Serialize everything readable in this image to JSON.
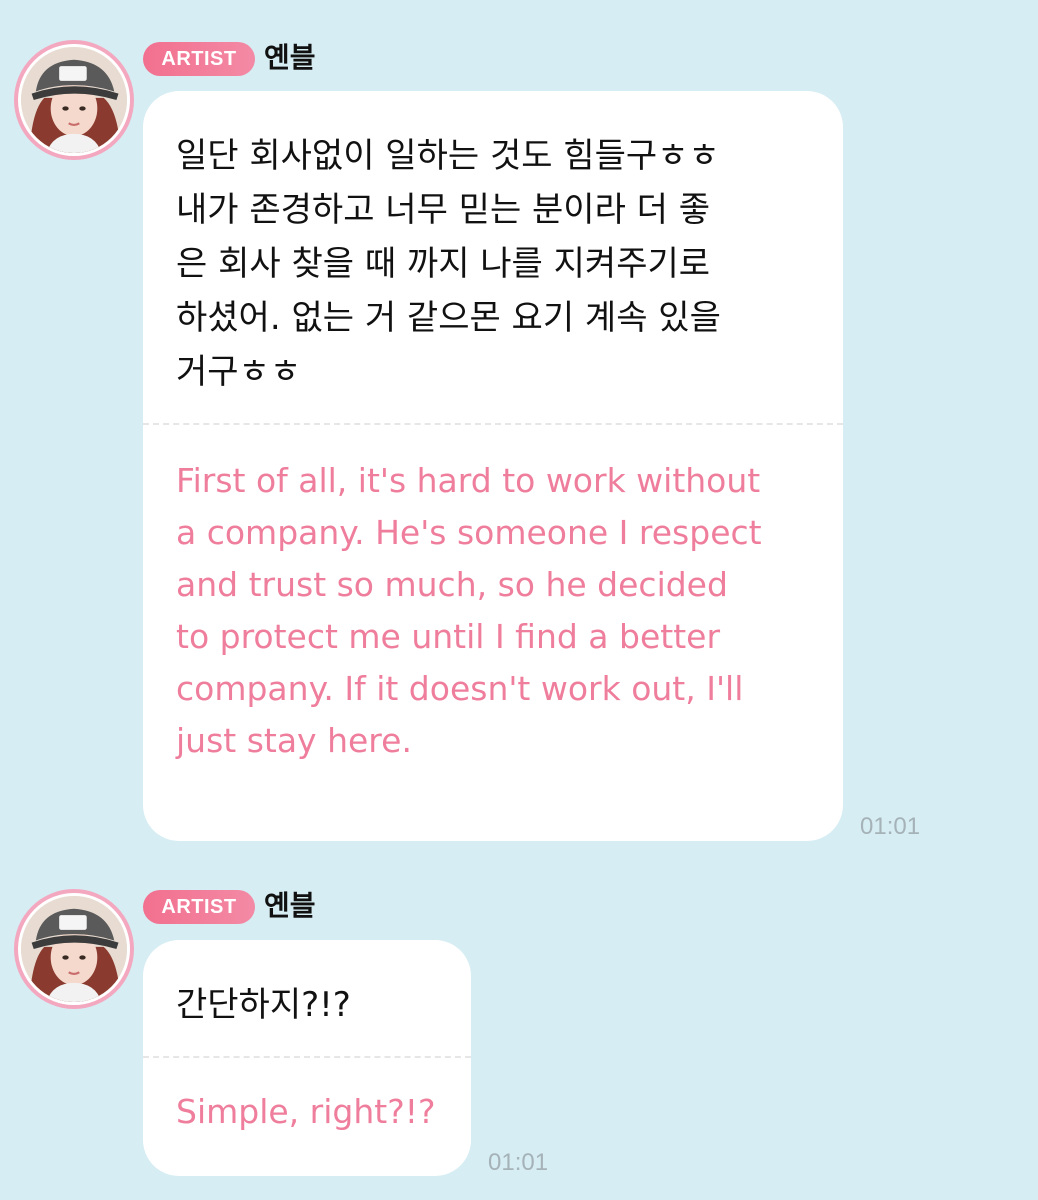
{
  "messages": [
    {
      "badge": "ARTIST",
      "sender": "옌블",
      "original_lines": [
        "일단 회사없이 일하는 것도 힘들구ㅎㅎ",
        "내가 존경하고 너무 믿는 분이라 더 좋",
        "은 회사 찾을 때 까지 나를 지켜주기로",
        "하셨어. 없는 거 같으몬 요기 계속 있을",
        "거구ㅎㅎ"
      ],
      "translation_lines": [
        "First of all, it's hard to work without",
        "a company. He's someone I respect",
        "and trust so much, so he decided",
        "to protect me until I find a better",
        "company. If it doesn't work out, I'll",
        "just stay here."
      ],
      "time": "01:01"
    },
    {
      "badge": "ARTIST",
      "sender": "옌블",
      "original_lines": [
        "간단하지?!?"
      ],
      "translation_lines": [
        "Simple, right?!?"
      ],
      "time": "01:01"
    }
  ],
  "colors": {
    "background": "#d6edf3",
    "badge": "#f2708f",
    "translation_text": "#ef7d9c",
    "timestamp": "#a5b2b7"
  }
}
